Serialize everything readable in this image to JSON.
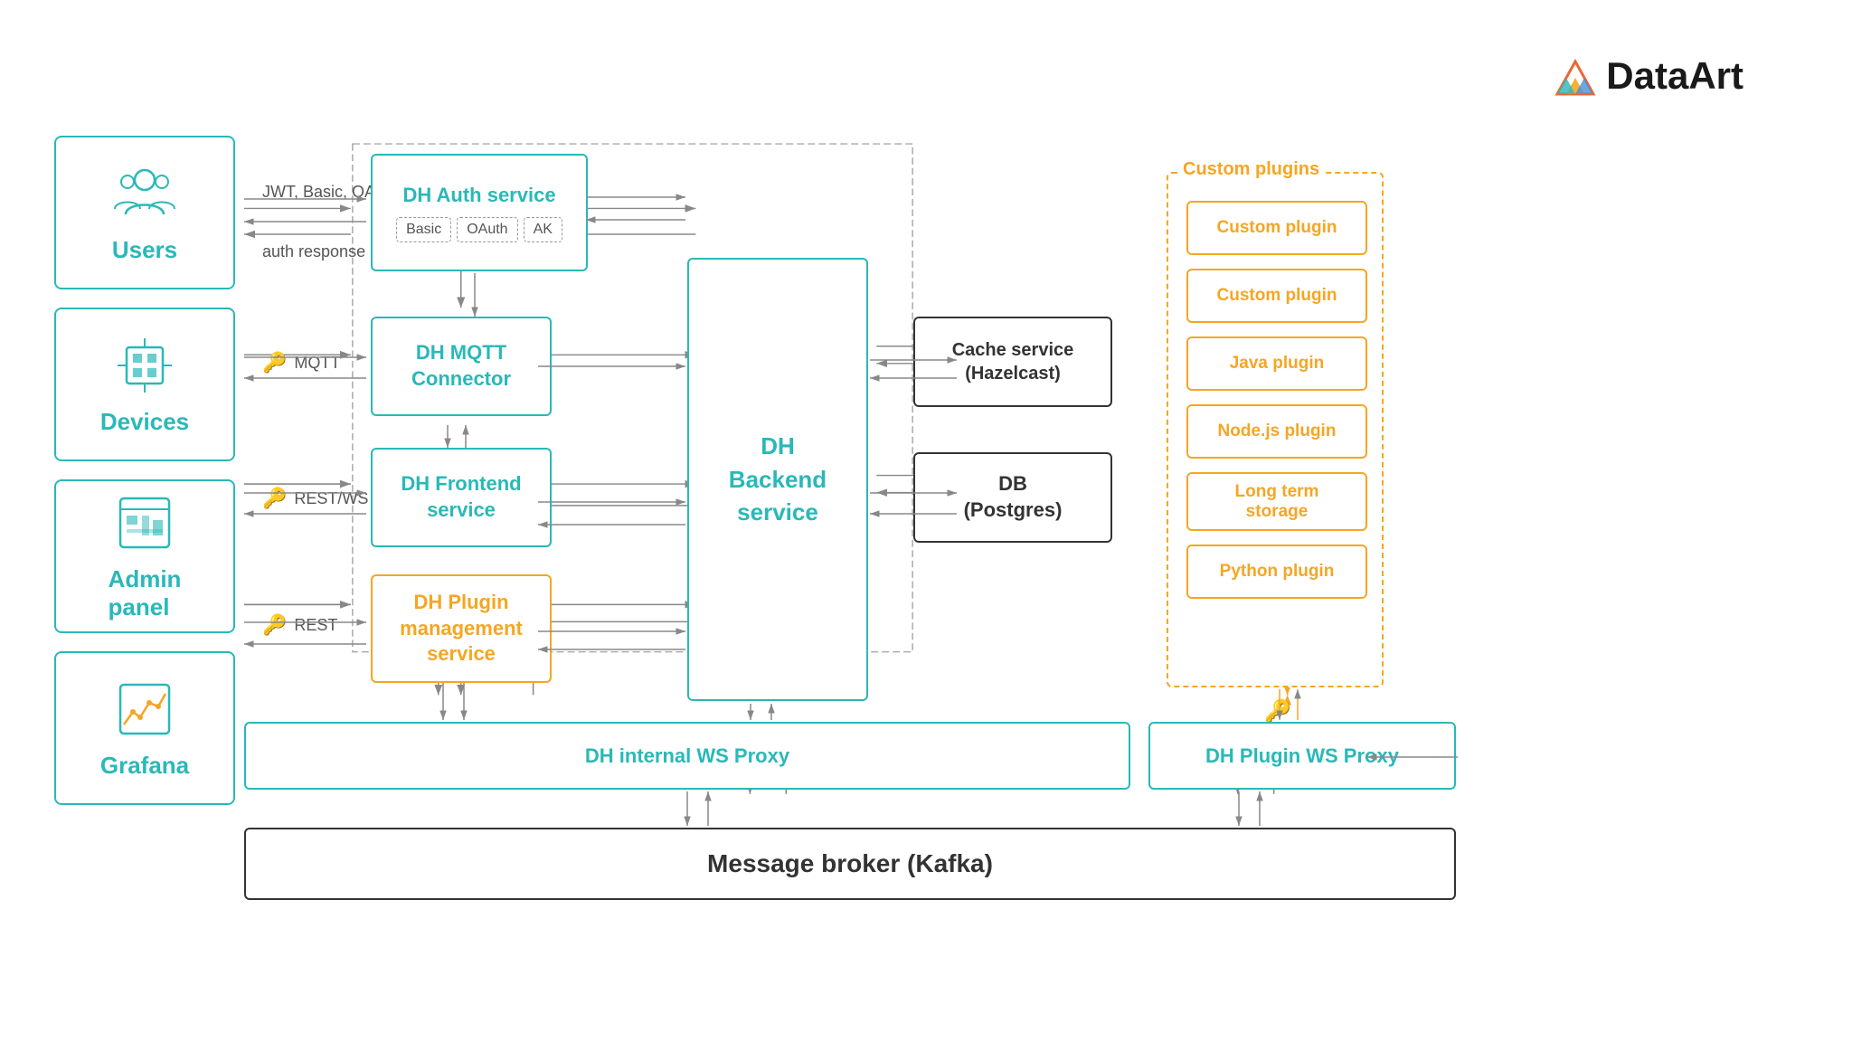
{
  "logo": {
    "text": "DataArt"
  },
  "actors": [
    {
      "id": "users",
      "label": "Users",
      "icon": "users"
    },
    {
      "id": "devices",
      "label": "Devices",
      "icon": "devices"
    },
    {
      "id": "admin",
      "label": "Admin\npanel",
      "icon": "admin"
    },
    {
      "id": "grafana",
      "label": "Grafana",
      "icon": "grafana"
    }
  ],
  "auth_labels": {
    "auth_request": "JWT, Basic,\nOAuth, AK\nauth request",
    "auth_response": "auth response"
  },
  "protocol_labels": {
    "mqtt": "MQTT",
    "rest_ws": "REST/WS",
    "rest": "REST"
  },
  "services": {
    "auth": {
      "title": "DH Auth service"
    },
    "mqtt": {
      "title": "DH MQTT\nConnector"
    },
    "frontend": {
      "title": "DH Frontend\nservice"
    },
    "plugin_mgmt": {
      "title": "DH Plugin\nmanagement\nservice"
    },
    "backend": {
      "title": "DH\nBackend\nservice"
    },
    "cache": {
      "title": "Cache service\n(Hazelcast)"
    },
    "db": {
      "title": "DB\n(Postgres)"
    },
    "ws_proxy_internal": {
      "title": "DH internal WS Proxy"
    },
    "ws_proxy_plugin": {
      "title": "DH Plugin WS Proxy"
    },
    "message_broker": {
      "title": "Message broker (Kafka)"
    }
  },
  "auth_badges": [
    "Basic",
    "OAuth",
    "AK"
  ],
  "custom_plugins": {
    "title": "Custom plugins",
    "plugins": [
      "Custom plugin",
      "Custom plugin",
      "Java plugin",
      "Node.js plugin",
      "Long term\nstorage",
      "Python plugin"
    ]
  }
}
